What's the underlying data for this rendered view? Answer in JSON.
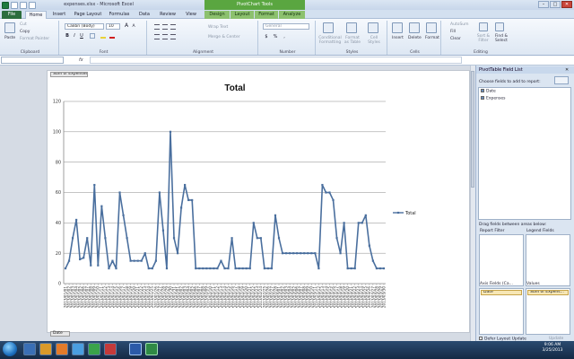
{
  "window": {
    "title": "expenses.xlsx - Microsoft Excel",
    "contextual": "PivotChart Tools",
    "controls": [
      "–",
      "□",
      "✕"
    ]
  },
  "tabs": [
    {
      "id": "file",
      "label": "File"
    },
    {
      "id": "home",
      "label": "Home"
    },
    {
      "id": "insert",
      "label": "Insert"
    },
    {
      "id": "pagelayout",
      "label": "Page Layout"
    },
    {
      "id": "formulas",
      "label": "Formulas"
    },
    {
      "id": "data",
      "label": "Data"
    },
    {
      "id": "review",
      "label": "Review"
    },
    {
      "id": "view",
      "label": "View"
    },
    {
      "id": "design",
      "label": "Design"
    },
    {
      "id": "layout",
      "label": "Layout"
    },
    {
      "id": "format",
      "label": "Format"
    },
    {
      "id": "analyze",
      "label": "Analyze"
    }
  ],
  "ribbon": {
    "clipboard": {
      "label": "Clipboard",
      "paste": "Paste",
      "cut": "Cut",
      "copy": "Copy",
      "format_painter": "Format Painter"
    },
    "font": {
      "label": "Font",
      "name": "Calibri (Body)",
      "size": "10",
      "bold": "B",
      "italic": "I",
      "underline": "U",
      "grow": "A",
      "shrink": "A"
    },
    "alignment": {
      "label": "Alignment",
      "wrap": "Wrap Text",
      "merge": "Merge & Center"
    },
    "number": {
      "label": "Number",
      "format": "General",
      "currency": "$",
      "percent": "%",
      "comma": ","
    },
    "styles": {
      "label": "Styles",
      "conditional": "Conditional Formatting",
      "table": "Format as Table",
      "cell": "Cell Styles"
    },
    "cells": {
      "label": "Cells",
      "insert": "Insert",
      "delete": "Delete",
      "format": "Format"
    },
    "editing": {
      "label": "Editing",
      "autosum": "AutoSum",
      "fill": "Fill",
      "clear": "Clear",
      "sort": "Sort & Filter",
      "find": "Find & Select"
    }
  },
  "formula_bar": {
    "fx": "fx"
  },
  "pivot_chart": {
    "field_button": "Sum of Expenses",
    "axis_button": "Date",
    "legend": "Total"
  },
  "chart_data": {
    "type": "line",
    "title": "Total",
    "xlabel": "",
    "ylabel": "",
    "ylim": [
      0,
      120
    ],
    "yticks": [
      0,
      20,
      40,
      60,
      80,
      100,
      120
    ],
    "grid": true,
    "legend": "right",
    "color": "#4a6f9e",
    "x": [
      "2013/01/01",
      "2013/01/02",
      "2013/01/03",
      "2013/01/04",
      "2013/01/05",
      "2013/01/06",
      "2013/01/07",
      "2013/01/08",
      "2013/01/09",
      "2013/01/10",
      "2013/01/11",
      "2013/01/12",
      "2013/01/13",
      "2013/01/14",
      "2013/01/15",
      "2013/01/16",
      "2013/01/17",
      "2013/01/18",
      "2013/01/19",
      "2013/01/20",
      "2013/01/21",
      "2013/01/22",
      "2013/01/23",
      "2013/01/24",
      "2013/01/25",
      "2013/01/26",
      "2013/01/27",
      "2013/01/28",
      "2013/01/29",
      "2013/01/30",
      "2013/01/31",
      "2013/02/01",
      "2013/02/02",
      "2013/02/03",
      "2013/02/04",
      "2013/02/05",
      "2013/02/06",
      "2013/02/07",
      "2013/02/08",
      "2013/02/09",
      "2013/02/10",
      "2013/02/11",
      "2013/02/12",
      "2013/02/13",
      "2013/02/14",
      "2013/02/15",
      "2013/02/16",
      "2013/02/17",
      "2013/02/18",
      "2013/02/19",
      "2013/02/20",
      "2013/02/21",
      "2013/02/22",
      "2013/02/23",
      "2013/02/24",
      "2013/02/25",
      "2013/02/26",
      "2013/02/27",
      "2013/02/28",
      "2013/03/01",
      "2013/03/02",
      "2013/03/03",
      "2013/03/04",
      "2013/03/05",
      "2013/03/06",
      "2013/03/07",
      "2013/03/08",
      "2013/03/09",
      "2013/03/10",
      "2013/03/11",
      "2013/03/12",
      "2013/03/13",
      "2013/03/14",
      "2013/03/15",
      "2013/03/16",
      "2013/03/17",
      "2013/03/18",
      "2013/03/19",
      "2013/03/20",
      "2013/03/21",
      "2013/03/22",
      "2013/03/23",
      "2013/03/24",
      "2013/03/25",
      "2013/03/26",
      "2013/03/27",
      "2013/03/28",
      "2013/03/29",
      "2013/03/30"
    ],
    "series": [
      {
        "name": "Total",
        "values": [
          10,
          15,
          30,
          42,
          16,
          17,
          30,
          12,
          65,
          12,
          51,
          30,
          10,
          15,
          10,
          60,
          45,
          30,
          15,
          15,
          15,
          15,
          20,
          10,
          10,
          15,
          60,
          35,
          10,
          100,
          30,
          20,
          50,
          65,
          55,
          55,
          10,
          10,
          10,
          10,
          10,
          10,
          10,
          15,
          10,
          10,
          30,
          10,
          10,
          10,
          10,
          10,
          40,
          30,
          30,
          10,
          10,
          10,
          45,
          30,
          20,
          20,
          20,
          20,
          20,
          20,
          20,
          20,
          20,
          20,
          10,
          65,
          60,
          60,
          55,
          30,
          20,
          40,
          10,
          10,
          10,
          40,
          40,
          45,
          25,
          15,
          10,
          10,
          10
        ]
      }
    ]
  },
  "field_list": {
    "title": "PivotTable Field List",
    "close": "✕",
    "choose_label": "Choose fields to add to report:",
    "fields": [
      {
        "label": "Date",
        "checked": true
      },
      {
        "label": "Expenses",
        "checked": true
      }
    ],
    "drag_label": "Drag fields between areas below:",
    "zones": {
      "report_filter": "Report Filter",
      "legend_fields": "Legend Fields",
      "axis_fields": "Axis Fields (Ca...",
      "values": "Values"
    },
    "axis_item": "Date",
    "values_item": "Sum of Expens...",
    "defer": "Defer Layout Update",
    "update": "Update"
  },
  "taskbar": {
    "time": "9:06 AM",
    "date": "3/25/2013"
  }
}
